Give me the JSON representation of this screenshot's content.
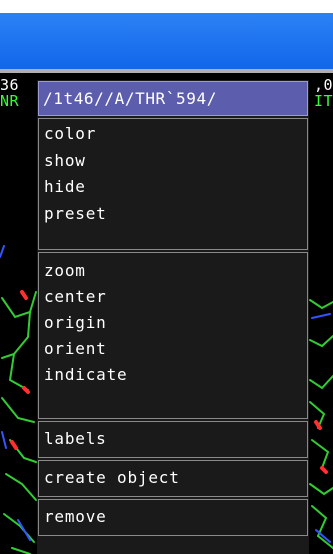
{
  "background": {
    "left_line1": "36",
    "left_line2": "NR",
    "right_line1": ",0",
    "right_line2": "IT"
  },
  "menu": {
    "title": "/1t46//A/THR`594/",
    "groups": [
      [
        "color",
        "show",
        "hide",
        "preset"
      ],
      [
        "zoom",
        "center",
        "origin",
        "orient",
        "indicate"
      ],
      [
        "labels"
      ],
      [
        "create object"
      ],
      [
        "remove"
      ]
    ]
  },
  "colors": {
    "title_bar": "#1b6ff0",
    "menu_title_bg": "#5d5dad",
    "menu_bg": "#1a1a1a",
    "menu_border": "#8a8a8a",
    "text_green": "#33ff33"
  }
}
